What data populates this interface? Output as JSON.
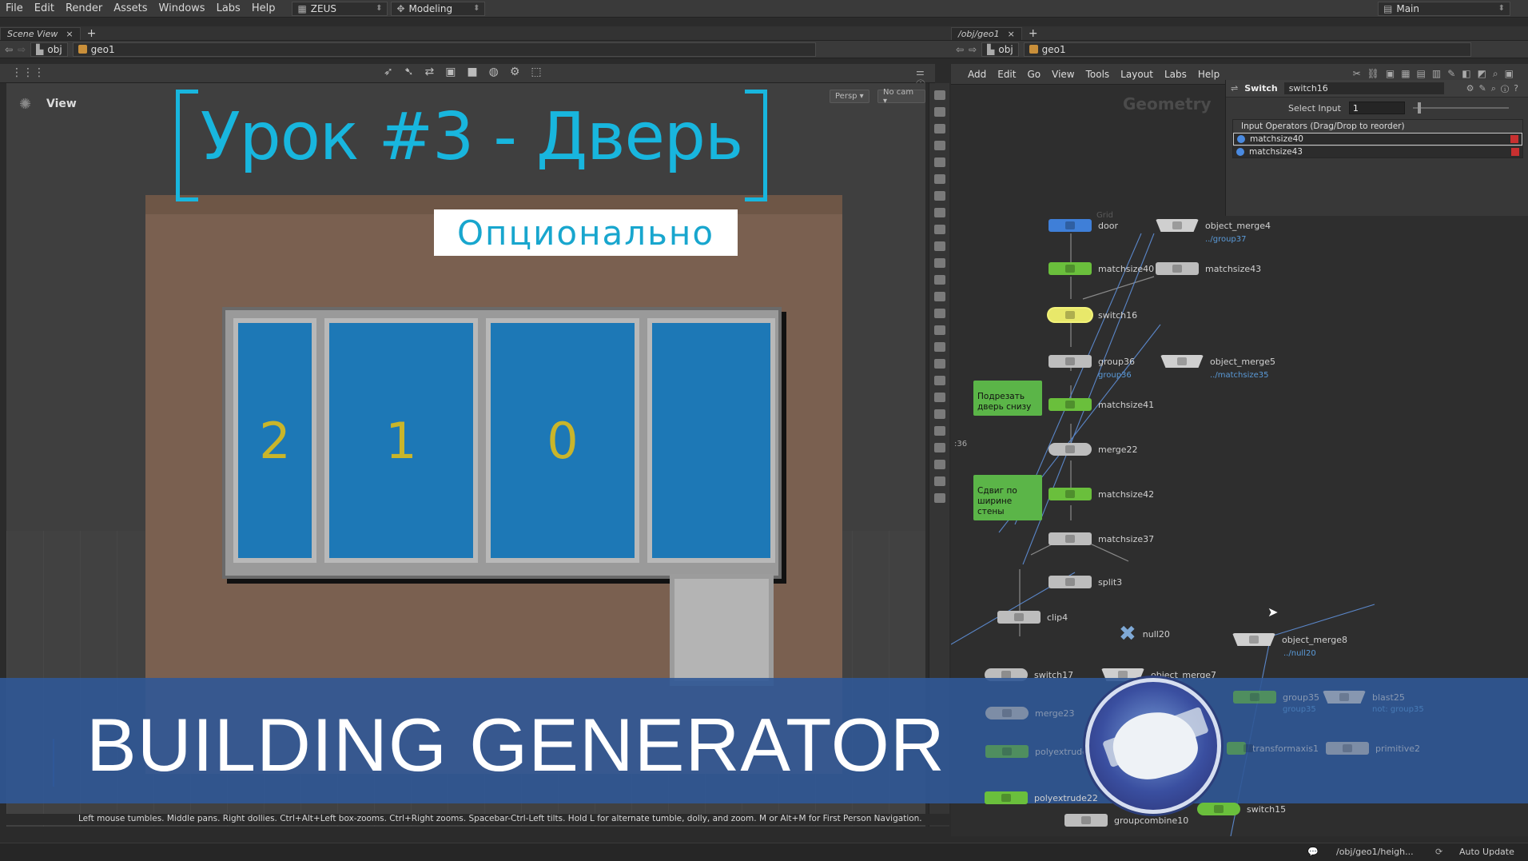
{
  "menu": {
    "items": [
      "File",
      "Edit",
      "Render",
      "Assets",
      "Windows",
      "Labs",
      "Help"
    ]
  },
  "desktop": {
    "name": "ZEUS",
    "shelf": "Modeling",
    "right": "Main"
  },
  "left_pane": {
    "tab": "Scene View",
    "path": [
      "obj",
      "geo1"
    ],
    "view_label": "View",
    "persp": "Persp ▾",
    "cam": "No cam ▾"
  },
  "overlay": {
    "title": "Урок #3 - Дверь",
    "subtitle": "Опционально",
    "banner": "BUILDING GENERATOR"
  },
  "window_digits": [
    "2",
    "1",
    "0"
  ],
  "right_pane": {
    "tab": "/obj/geo1",
    "path": [
      "obj",
      "geo1"
    ],
    "menu": [
      "Add",
      "Edit",
      "Go",
      "View",
      "Tools",
      "Layout",
      "Labs",
      "Help"
    ],
    "context_label": "Geometry"
  },
  "params": {
    "type": "Switch",
    "node_name": "switch16",
    "select_label": "Select Input",
    "select_value": "1",
    "list_header": "Input Operators (Drag/Drop to reorder)",
    "inputs": [
      "matchsize40",
      "matchsize43"
    ]
  },
  "nodes": {
    "door": "door",
    "door_tag": "Grid",
    "object_merge4": "object_merge4",
    "object_merge4_sub": "../group37",
    "matchsize40": "matchsize40",
    "matchsize43": "matchsize43",
    "switch16": "switch16",
    "group36": "group36",
    "group36_sub": "group36",
    "object_merge5": "object_merge5",
    "object_merge5_sub": "../matchsize35",
    "matchsize41": "matchsize41",
    "merge22": "merge22",
    "matchsize42": "matchsize42",
    "matchsize37": "matchsize37",
    "split3": "split3",
    "clip4": "clip4",
    "null20": "null20",
    "object_merge8": "object_merge8",
    "object_merge8_sub": "../null20",
    "switch17": "switch17",
    "object_merge7": "object_merge7",
    "merge23": "merge23",
    "polyextrude": "polyextrude",
    "polyextrude22": "polyextrude22",
    "group35": "group35",
    "group35_sub": "group35",
    "blast25": "blast25",
    "blast25_sub": "not: group35",
    "transformaxis1": "transformaxis1",
    "primitive2": "primitive2",
    "switch15": "switch15",
    "groupcombine10": "groupcombine10",
    "edge_label": ":36"
  },
  "stickies": {
    "note1": "Подрезать дверь снизу",
    "note2": "Сдвиг по ширине стены"
  },
  "hint": "Left mouse tumbles. Middle pans. Right dollies. Ctrl+Alt+Left box-zooms. Ctrl+Right zooms. Spacebar-Ctrl-Left tilts. Hold L for alternate tumble, dolly, and zoom. M or Alt+M for First Person Navigation.",
  "status": {
    "path": "/obj/geo1/heigh...",
    "update": "Auto Update"
  }
}
